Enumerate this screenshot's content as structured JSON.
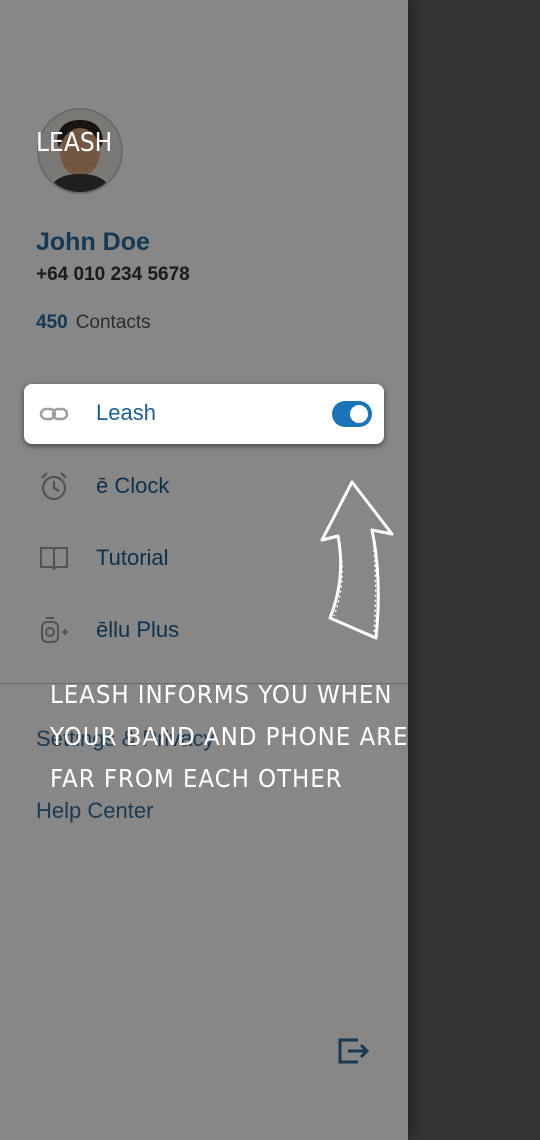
{
  "profile": {
    "name": "John Doe",
    "phone": "+64 010 234 5678",
    "contacts_count": "450",
    "contacts_label": "Contacts"
  },
  "menu": {
    "items": [
      {
        "label": "Leash",
        "icon": "link-icon",
        "toggle": true
      },
      {
        "label": "ē Clock",
        "icon": "alarm-clock-icon"
      },
      {
        "label": "Tutorial",
        "icon": "book-icon"
      },
      {
        "label": "ēllu Plus",
        "icon": "ellu-plus-icon"
      }
    ]
  },
  "links": {
    "settings": "Settings & Privacy",
    "help": "Help Center"
  },
  "coach": {
    "title": "LEASH",
    "lines": [
      "LEASH INFORMS YOU WHEN",
      "YOUR BAND AND PHONE ARE",
      "FAR FROM EACH OTHER"
    ]
  },
  "colors": {
    "accent": "#1b73b8",
    "name": "#2a6a9e"
  }
}
